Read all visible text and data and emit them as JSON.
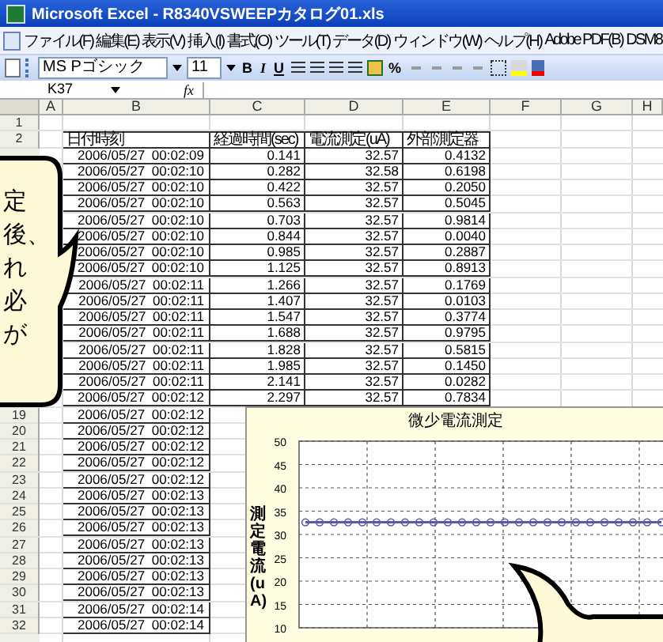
{
  "window": {
    "title": "Microsoft Excel - R8340VSWEEPカタログ01.xls"
  },
  "menu": [
    {
      "label": "ファイル(F)"
    },
    {
      "label": "編集(E)"
    },
    {
      "label": "表示(V)"
    },
    {
      "label": "挿入(I)"
    },
    {
      "label": "書式(O)"
    },
    {
      "label": "ツール(T)"
    },
    {
      "label": "データ(D)"
    },
    {
      "label": "ウィンドウ(W)"
    },
    {
      "label": "ヘルプ(H)"
    },
    {
      "label": "Adobe PDF(B)"
    },
    {
      "label": "DSM8"
    }
  ],
  "toolbar": {
    "font": "MS Pゴシック",
    "size": "11",
    "format_buttons": [
      "B",
      "I",
      "U"
    ],
    "percent": "%"
  },
  "formula_bar": {
    "name_box": "K37",
    "fx": "fx"
  },
  "sheet": {
    "columns": [
      "A",
      "B",
      "C",
      "D",
      "E",
      "F",
      "G",
      "H"
    ],
    "rows": [
      {
        "number": "1"
      },
      {
        "number": "2",
        "kind": "header",
        "b": "日付時刻",
        "c": "経過時間(sec)",
        "d": "電流測定(uA)",
        "e": "外部測定器"
      },
      {
        "kind": "data",
        "b": "2006/05/27  00:02:09",
        "c": "0.141",
        "d": "32.57",
        "e": "0.4132"
      },
      {
        "kind": "data",
        "b": "2006/05/27  00:02:10",
        "c": "0.282",
        "d": "32.58",
        "e": "0.6198"
      },
      {
        "kind": "data",
        "b": "2006/05/27  00:02:10",
        "c": "0.422",
        "d": "32.57",
        "e": "0.2050"
      },
      {
        "kind": "data",
        "b": "2006/05/27  00:02:10",
        "c": "0.563",
        "d": "32.57",
        "e": "0.5045"
      },
      {
        "kind": "data",
        "b": "2006/05/27  00:02:10",
        "c": "0.703",
        "d": "32.57",
        "e": "0.9814"
      },
      {
        "kind": "data",
        "b": "2006/05/27  00:02:10",
        "c": "0.844",
        "d": "32.57",
        "e": "0.0040"
      },
      {
        "kind": "data",
        "b": "2006/05/27  00:02:10",
        "c": "0.985",
        "d": "32.57",
        "e": "0.2887"
      },
      {
        "kind": "data",
        "b": "2006/05/27  00:02:10",
        "c": "1.125",
        "d": "32.57",
        "e": "0.8913"
      },
      {
        "kind": "data",
        "b": "2006/05/27  00:02:11",
        "c": "1.266",
        "d": "32.57",
        "e": "0.1769"
      },
      {
        "kind": "data",
        "b": "2006/05/27  00:02:11",
        "c": "1.407",
        "d": "32.57",
        "e": "0.0103"
      },
      {
        "kind": "data",
        "b": "2006/05/27  00:02:11",
        "c": "1.547",
        "d": "32.57",
        "e": "0.3774"
      },
      {
        "kind": "data",
        "b": "2006/05/27  00:02:11",
        "c": "1.688",
        "d": "32.57",
        "e": "0.9795"
      },
      {
        "kind": "data",
        "b": "2006/05/27  00:02:11",
        "c": "1.828",
        "d": "32.57",
        "e": "0.5815"
      },
      {
        "kind": "data",
        "b": "2006/05/27  00:02:11",
        "c": "1.985",
        "d": "32.57",
        "e": "0.1450"
      },
      {
        "kind": "data",
        "b": "2006/05/27  00:02:11",
        "c": "2.141",
        "d": "32.57",
        "e": "0.0282"
      },
      {
        "kind": "data",
        "b": "2006/05/27  00:02:12",
        "c": "2.297",
        "d": "32.57",
        "e": "0.7834"
      },
      {
        "number": "19",
        "kind": "data",
        "b": "2006/05/27  00:02:12"
      },
      {
        "number": "20",
        "kind": "data",
        "b": "2006/05/27  00:02:12"
      },
      {
        "number": "21",
        "kind": "data",
        "b": "2006/05/27  00:02:12"
      },
      {
        "number": "22",
        "kind": "data",
        "b": "2006/05/27  00:02:12"
      },
      {
        "number": "23",
        "kind": "data",
        "b": "2006/05/27  00:02:12"
      },
      {
        "number": "24",
        "kind": "data",
        "b": "2006/05/27  00:02:13"
      },
      {
        "number": "25",
        "kind": "data",
        "b": "2006/05/27  00:02:13"
      },
      {
        "number": "26",
        "kind": "data",
        "b": "2006/05/27  00:02:13"
      },
      {
        "number": "27",
        "kind": "data",
        "b": "2006/05/27  00:02:13"
      },
      {
        "number": "28",
        "kind": "data",
        "b": "2006/05/27  00:02:13"
      },
      {
        "number": "29",
        "kind": "data",
        "b": "2006/05/27  00:02:13"
      },
      {
        "number": "30",
        "kind": "data",
        "b": "2006/05/27  00:02:13"
      },
      {
        "number": "31",
        "kind": "data",
        "b": "2006/05/27  00:02:14"
      },
      {
        "number": "32",
        "kind": "data",
        "b": "2006/05/27  00:02:14"
      }
    ]
  },
  "chart": {
    "chart_data": {
      "type": "line",
      "title": "微少電流測定",
      "ylabel": "測定電流(uA)",
      "ylim": [
        10,
        50
      ],
      "yticks": [
        10,
        15,
        20,
        25,
        30,
        35,
        40,
        45,
        50
      ],
      "grid": true,
      "series": [
        {
          "color": "#5a5aa8",
          "marker": "circle",
          "values": [
            32.6,
            32.6,
            32.6,
            32.6,
            32.6,
            32.6,
            32.6,
            32.6,
            32.6,
            32.6,
            32.6,
            32.6,
            32.6,
            32.6,
            32.6,
            32.6,
            32.6,
            32.6,
            32.6,
            32.6,
            32.6,
            32.6,
            32.6,
            32.6,
            32.6,
            32.6
          ]
        }
      ]
    }
  },
  "callouts": [
    {
      "kind": "left",
      "lines": [
        "定",
        "後、",
        "れ",
        "必",
        "が"
      ]
    },
    {
      "kind": "bottom"
    }
  ]
}
